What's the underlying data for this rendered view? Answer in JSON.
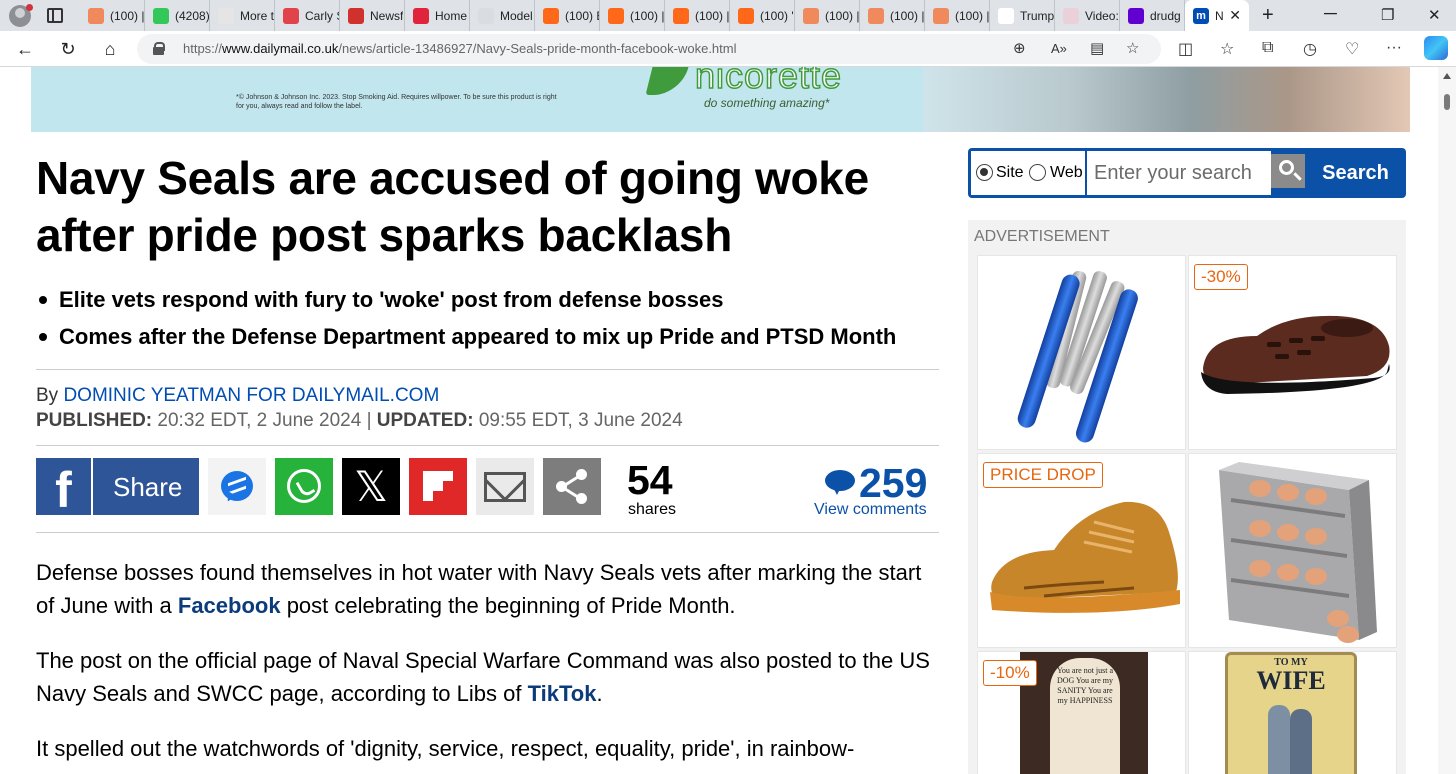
{
  "browser": {
    "tabs": [
      {
        "title": "(100) |",
        "favicon_color": "#f08a5d"
      },
      {
        "title": "(4208)",
        "favicon_color": "#34c759"
      },
      {
        "title": "More t",
        "favicon_color": "#e5e5e5"
      },
      {
        "title": "Carly S",
        "favicon_color": "#e0434a"
      },
      {
        "title": "Newsf",
        "favicon_color": "#d0312d"
      },
      {
        "title": "Home",
        "favicon_color": "#e0243c"
      },
      {
        "title": "Model",
        "favicon_color": "#d9dde2"
      },
      {
        "title": "(100) E",
        "favicon_color": "#ff6719"
      },
      {
        "title": "(100) |",
        "favicon_color": "#ff6719"
      },
      {
        "title": "(100) |",
        "favicon_color": "#ff6719"
      },
      {
        "title": "(100) '",
        "favicon_color": "#ff6719"
      },
      {
        "title": "(100) |",
        "favicon_color": "#f08a5d"
      },
      {
        "title": "(100) |",
        "favicon_color": "#f08a5d"
      },
      {
        "title": "(100) |",
        "favicon_color": "#f08a5d"
      },
      {
        "title": "Trump",
        "favicon_color": "#ffffff"
      },
      {
        "title": "Video:",
        "favicon_color": "#e9d0d9"
      },
      {
        "title": "drudg",
        "favicon_color": "#6001d2"
      }
    ],
    "active_tab": {
      "title": "N",
      "favicon_color": "#004db3",
      "favicon_letter": "m"
    },
    "new_tab_label": "+",
    "url_prefix": "https://",
    "url_domain": "www.dailymail.co.uk",
    "url_path": "/news/article-13486927/Navy-Seals-pride-month-facebook-woke.html"
  },
  "top_ad": {
    "disclaimer": "*© Johnson & Johnson Inc. 2023. Stop Smoking Aid. Requires willpower. To be sure this product is right for you, always read and follow the label.",
    "brand": "nicorette",
    "slogan": "do something amazing*"
  },
  "article": {
    "headline": "Navy Seals are accused of going woke after pride post sparks backlash",
    "bullets": [
      "Elite vets respond with fury to 'woke' post from defense bosses",
      "Comes after the Defense Department appeared to mix up Pride and PTSD Month"
    ],
    "byline_prefix": "By ",
    "author": "DOMINIC YEATMAN FOR DAILYMAIL.COM",
    "published_label": "PUBLISHED:",
    "published_value": " 20:32 EDT, 2 June 2024 ",
    "separator": "|",
    "updated_label": " UPDATED:",
    "updated_value": " 09:55 EDT, 3 June 2024",
    "share_label": "Share",
    "share_count": "54",
    "share_count_label": "shares",
    "comment_count": "259",
    "view_comments_label": "View comments",
    "paragraphs": [
      {
        "before": "Defense bosses found themselves in hot water with Navy Seals vets after marking the start of June with a ",
        "link": "Facebook",
        "after": " post celebrating the beginning of Pride Month."
      },
      {
        "before": "The post on the official page of Naval Special Warfare Command was also posted to the US Navy Seals and SWCC page, according to Libs of ",
        "link": "TikTok",
        "after": "."
      },
      {
        "before": "It spelled out the watchwords of 'dignity, service, respect, equality, pride', in rainbow-",
        "link": "",
        "after": ""
      }
    ]
  },
  "sidebar": {
    "search": {
      "options": [
        "Site",
        "Web"
      ],
      "selected": "Site",
      "placeholder": "Enter your search",
      "button_label": "Search"
    },
    "ad_label": "ADVERTISEMENT",
    "ad_items": [
      {
        "product": "multi-tool",
        "badge": ""
      },
      {
        "product": "leather sandal",
        "badge": "-30%"
      },
      {
        "product": "sneaker",
        "badge": "PRICE DROP"
      },
      {
        "product": "egg dispenser",
        "badge": ""
      },
      {
        "product": "sign",
        "badge": "-10%"
      },
      {
        "product": "metal sign",
        "badge": ""
      }
    ],
    "sign_texts": {
      "dark_sign": "You are not just a DOG You are my SANITY You are my HAPPINESS",
      "light_sign_line1": "TO MY",
      "light_sign_line2": "WIFE"
    }
  },
  "colors": {
    "dm_blue": "#004db3",
    "link_blue": "#0c3b7c",
    "facebook": "#2e5597",
    "whatsapp": "#27b33b",
    "flipboard": "#e12828",
    "badge_orange": "#e8660f"
  }
}
